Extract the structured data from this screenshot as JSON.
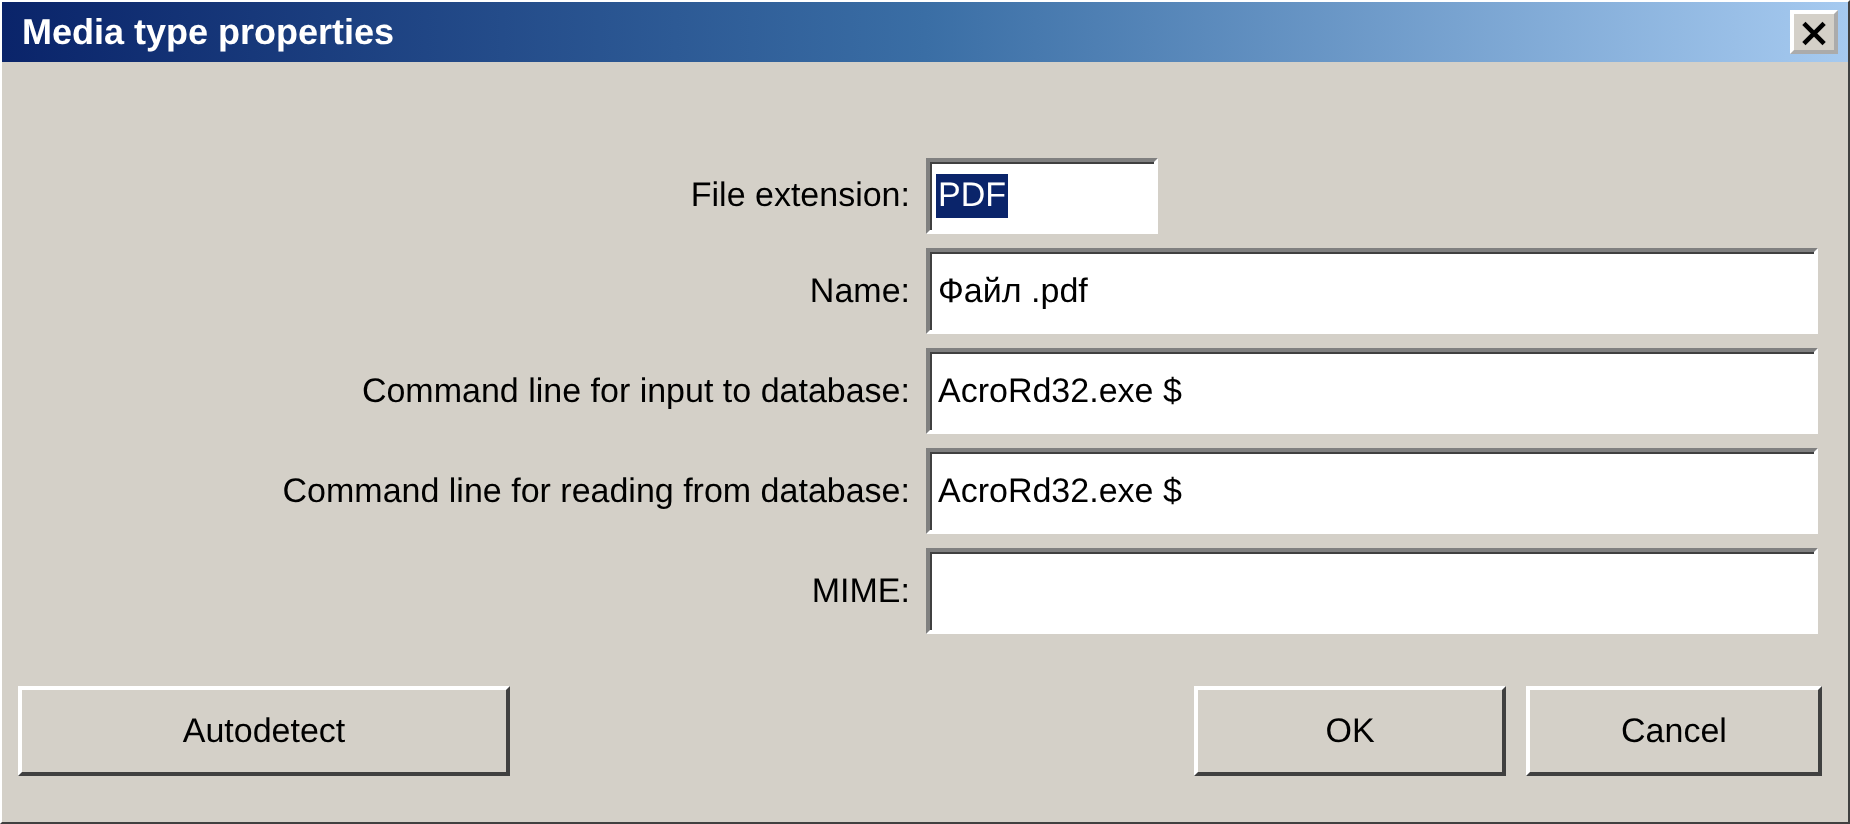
{
  "window": {
    "title": "Media type properties",
    "close": "×"
  },
  "fields": [
    {
      "label": "File extension:",
      "value": "PDF",
      "text_selected": true
    },
    {
      "label": "Name:",
      "value": "Файл .pdf"
    },
    {
      "label": "Command line for input to database:",
      "value": "AcroRd32.exe $"
    },
    {
      "label": "Command line for reading from database:",
      "value": "AcroRd32.exe $"
    },
    {
      "label": "MIME:"
    }
  ],
  "buttons": {
    "left": "Autodetect",
    "ok": "OK",
    "cancel": "Cancel"
  }
}
